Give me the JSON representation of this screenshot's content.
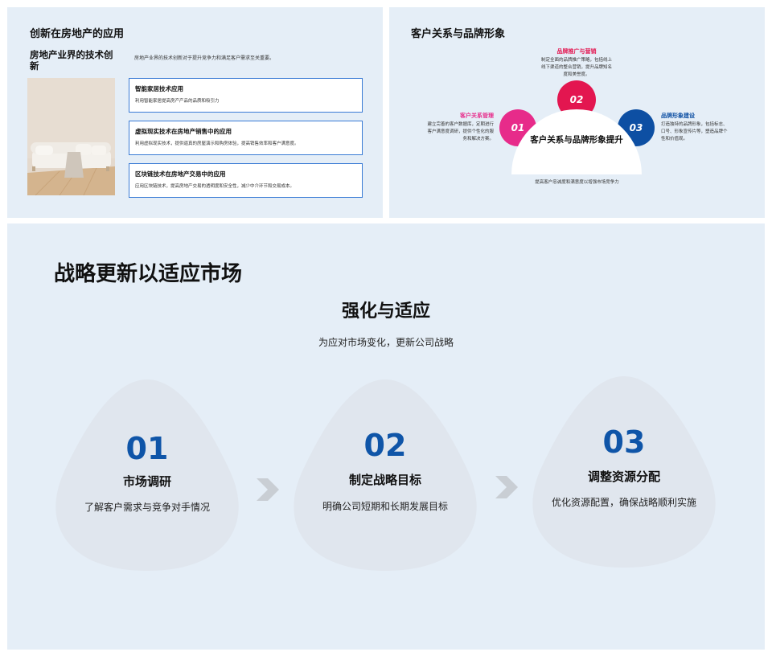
{
  "slide1": {
    "title": "创新在房地产的应用",
    "subtitle": "房地产业界的技术创新",
    "intro": "房地产业界的技术创新对于提升竞争力和满足客户需求至关重要。",
    "cards": [
      {
        "title": "智能家居技术应用",
        "desc": "利用智能家居提高房产产品的品质和吸引力"
      },
      {
        "title": "虚拟现实技术在房地产销售中的应用",
        "desc": "利用虚拟现实技术，提供逼真的房屋演示和购房体验，提高销售效率和客户满意度。"
      },
      {
        "title": "区块链技术在房地产交易中的应用",
        "desc": "应用区块链技术，提高房地产交易的透明度和安全性，减少中介环节和交易成本。"
      }
    ]
  },
  "slide2": {
    "title": "客户关系与品牌形象",
    "center": "客户关系与品牌形象提升",
    "bottom": "提高客户忠诚度和满意度以增强市场竞争力",
    "items": [
      {
        "num": "01",
        "title": "客户关系管理",
        "desc": "建立完善的客户数据库，定期进行客户满意度调研，提供个性化的服务和解决方案。",
        "color": "#e72b8a"
      },
      {
        "num": "02",
        "title": "品牌推广与营销",
        "desc": "制定全面的品牌推广策略，包括线上线下渠道的整合营销，提升品牌知名度和美誉度。",
        "color": "#e31650"
      },
      {
        "num": "03",
        "title": "品牌形象建设",
        "desc": "打造独特的品牌形象，包括标志、口号、形象宣传片等，塑造品牌个性和价值观。",
        "color": "#0d4fa3"
      }
    ]
  },
  "slide3": {
    "title": "战略更新以适应市场",
    "heading": "强化与适应",
    "subheading": "为应对市场变化，更新公司战略",
    "steps": [
      {
        "num": "01",
        "label": "市场调研",
        "desc": "了解客户需求与竞争对手情况"
      },
      {
        "num": "02",
        "label": "制定战略目标",
        "desc": "明确公司短期和长期发展目标"
      },
      {
        "num": "03",
        "label": "调整资源分配",
        "desc": "优化资源配置，确保战略顺利实施"
      }
    ]
  },
  "colors": {
    "background": "#e5eef7",
    "accent_blue": "#0f55a8",
    "card_border": "#3a7bd5",
    "shape_fill": "#e0e6ee"
  }
}
